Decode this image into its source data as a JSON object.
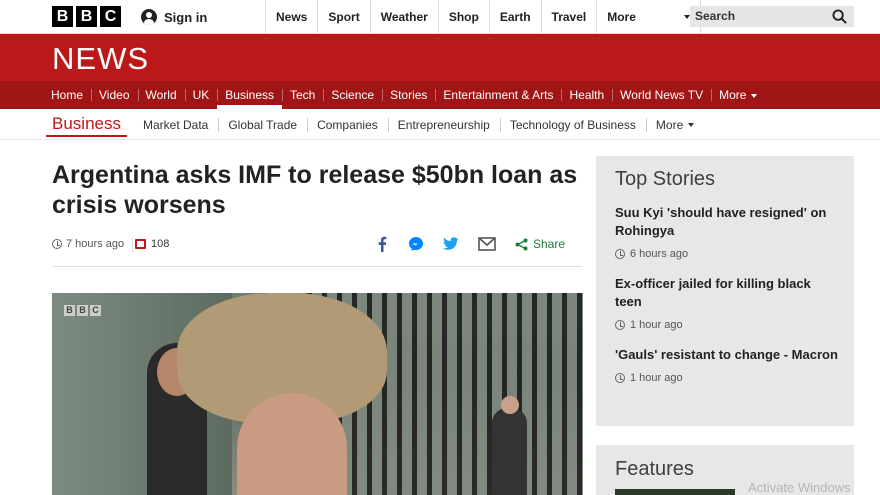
{
  "header": {
    "logo_letters": [
      "B",
      "B",
      "C"
    ],
    "signin_label": "Sign in",
    "nav": [
      "News",
      "Sport",
      "Weather",
      "Shop",
      "Earth",
      "Travel"
    ],
    "more_label": "More",
    "search_placeholder": "Search"
  },
  "masthead": {
    "title": "NEWS"
  },
  "section_nav": {
    "items": [
      "Home",
      "Video",
      "World",
      "UK",
      "Business",
      "Tech",
      "Science",
      "Stories",
      "Entertainment & Arts",
      "Health",
      "World News TV"
    ],
    "active": "Business",
    "more_label": "More"
  },
  "sub_nav": {
    "section_label": "Business",
    "items": [
      "Market Data",
      "Global Trade",
      "Companies",
      "Entrepreneurship",
      "Technology of Business"
    ],
    "more_label": "More"
  },
  "article": {
    "headline": "Argentina asks IMF to release $50bn loan as crisis worsens",
    "timestamp": "7 hours ago",
    "comment_count": "108",
    "share_label": "Share",
    "image_watermark": [
      "B",
      "B",
      "C"
    ]
  },
  "sidebar": {
    "top_stories_title": "Top Stories",
    "stories": [
      {
        "title": "Suu Kyi 'should have resigned' on Rohingya",
        "time": "6 hours ago"
      },
      {
        "title": "Ex-officer jailed for killing black teen",
        "time": "1 hour ago"
      },
      {
        "title": "'Gauls' resistant to change - Macron",
        "time": "1 hour ago"
      }
    ],
    "features_title": "Features"
  },
  "os_overlay": {
    "text": "Activate Windows"
  },
  "colors": {
    "brand_red": "#bb1919",
    "nav_red": "#a01616",
    "sidebar_bg": "#e7e7e7",
    "share_green": "#1e7d3a"
  }
}
